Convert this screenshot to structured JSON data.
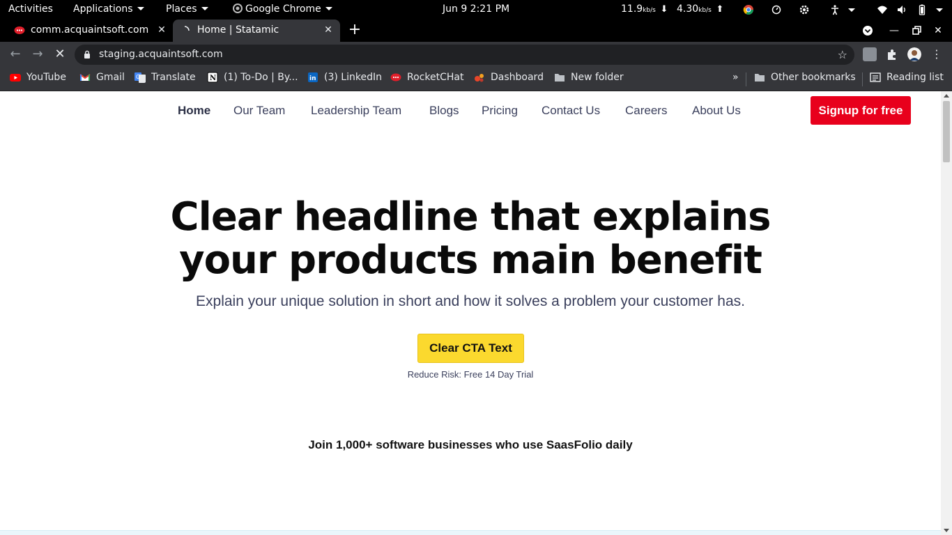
{
  "topbar": {
    "activities": "Activities",
    "applications": "Applications",
    "places": "Places",
    "app_name": "Google Chrome",
    "datetime": "Jun 9   2:21 PM",
    "download_speed": "11.9",
    "download_unit": "kb/s",
    "upload_speed": "4.30",
    "upload_unit": "kb/s"
  },
  "tabs": [
    {
      "title": "comm.acquaintsoft.com",
      "icon": "rocketchat-icon"
    },
    {
      "title": "Home | Statamic",
      "icon": "loading-icon"
    }
  ],
  "toolbar": {
    "url": "staging.acquaintsoft.com"
  },
  "bookmarks": {
    "items": [
      {
        "label": "YouTube",
        "icon": "youtube-icon"
      },
      {
        "label": "Gmail",
        "icon": "gmail-icon"
      },
      {
        "label": "Translate",
        "icon": "translate-icon"
      },
      {
        "label": "(1) To-Do | By...",
        "icon": "notion-icon"
      },
      {
        "label": "(3) LinkedIn",
        "icon": "linkedin-icon"
      },
      {
        "label": "RocketCHat",
        "icon": "rocketchat-icon"
      },
      {
        "label": "Dashboard",
        "icon": "dashboard-icon"
      },
      {
        "label": "New folder",
        "icon": "folder-icon"
      }
    ],
    "overflow": "»",
    "other": "Other bookmarks",
    "reading_list": "Reading list"
  },
  "site": {
    "nav": [
      "Home",
      "Our Team",
      "Leadership Team",
      "Blogs",
      "Pricing",
      "Contact Us",
      "Careers",
      "About Us"
    ],
    "signup": "Signup for free",
    "headline_line1": "Clear headline that explains",
    "headline_line2": "your products main benefit",
    "subline": "Explain your unique solution in short and how it solves a problem your customer has.",
    "cta": "Clear CTA Text",
    "risk": "Reduce Risk: Free 14 Day Trial",
    "join": "Join 1,000+ software businesses who use SaasFolio daily"
  },
  "colors": {
    "signup_bg": "#e8001c",
    "cta_bg": "#fbd92e",
    "nav_text": "#3a3f5c"
  }
}
